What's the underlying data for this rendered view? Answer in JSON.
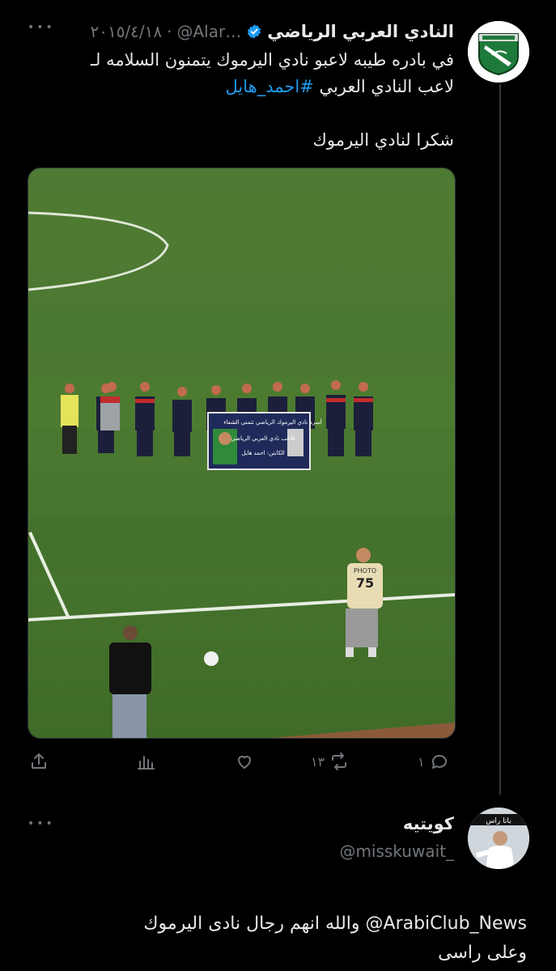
{
  "tweet1": {
    "display_name": "النادي العربي الرياضي",
    "handle": "@Alar…",
    "separator": "·",
    "date": "٢٠١٥/٤/١٨",
    "more": "•••",
    "text_line1": "في بادره طيبه لاعبو نادي اليرموك يتمنون السلامه لـ",
    "text_line2_prefix": "لاعب النادي العربي",
    "hashtag": "#احمد_هايل",
    "text_line3": "شكرا لنادي اليرموك",
    "media": {
      "banner_line1": "أسرة نادي اليرموك الرياضي تتمنى الشفاء",
      "banner_line2": "للاعب نادي العربي الرياضي",
      "banner_line3": "الكابتن: احمد هايل",
      "shirt_label": "PHOTO",
      "shirt_number": "75"
    },
    "actions": {
      "reply_count": "١",
      "retweet_count": "١٣",
      "like_count": "",
      "views_count": ""
    }
  },
  "tweet2": {
    "display_name": "كويتيه",
    "handle": "@misskuwait_",
    "more": "•••",
    "avatar_banner": "باتا راس",
    "text_line1": "ArabiClub_News@ والله انهم رجال نادى اليرموك",
    "text_line2": "وعلى راسى"
  },
  "colors": {
    "background": "#000000",
    "text": "#e7e9ea",
    "muted": "#71767b",
    "link": "#1d9bf0",
    "verified": "#1d9bf0",
    "thread_line": "#333639"
  }
}
